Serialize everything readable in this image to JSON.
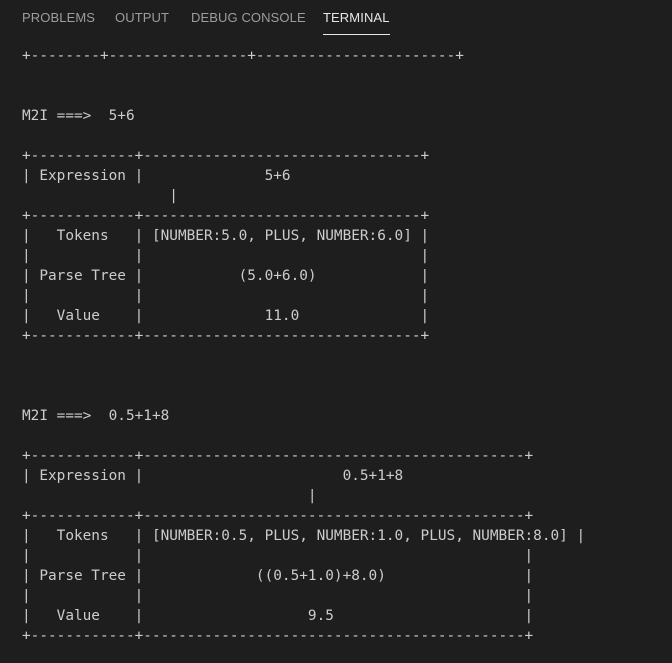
{
  "tabs": [
    {
      "label": "PROBLEMS",
      "active": false
    },
    {
      "label": "OUTPUT",
      "active": false
    },
    {
      "label": "DEBUG CONSOLE",
      "active": false
    },
    {
      "label": "TERMINAL",
      "active": true
    }
  ],
  "terminal_lines": [
    "+--------+----------------+-----------------------+",
    "",
    "",
    "M2I ===>  5+6",
    "",
    "+------------+--------------------------------+",
    "| Expression |              5+6",
    "                 |",
    "+------------+--------------------------------+",
    "|   Tokens   | [NUMBER:5.0, PLUS, NUMBER:6.0] |",
    "|            |                                |",
    "| Parse Tree |           (5.0+6.0)            |",
    "|            |                                |",
    "|   Value    |              11.0              |",
    "+------------+--------------------------------+",
    "",
    "",
    "",
    "M2I ===>  0.5+1+8",
    "",
    "+------------+--------------------------------------------+",
    "| Expression |                       0.5+1+8",
    "                                 |",
    "+------------+--------------------------------------------+",
    "|   Tokens   | [NUMBER:0.5, PLUS, NUMBER:1.0, PLUS, NUMBER:8.0] |",
    "|            |                                            |",
    "| Parse Tree |             ((0.5+1.0)+8.0)                |",
    "|            |                                            |",
    "|   Value    |                   9.5                      |",
    "+------------+--------------------------------------------+"
  ]
}
